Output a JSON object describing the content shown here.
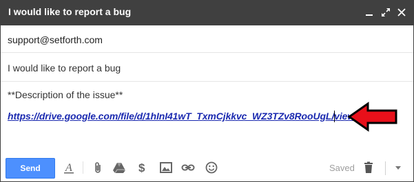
{
  "window": {
    "title": "I would like to report a bug",
    "minimize_icon": "minimize-icon",
    "expand_icon": "expand-icon",
    "close_icon": "close-icon"
  },
  "compose": {
    "to": "support@setforth.com",
    "subject": "I would like to report a bug",
    "body_line1": "**Description of the issue**",
    "body_link": "https://drive.google.com/file/d/1hInI41wT_TxmCjkkvc_WZ3TZv8RooUgL/view"
  },
  "toolbar": {
    "send_label": "Send",
    "saved_label": "Saved",
    "icons": [
      "format-text-icon",
      "attach-icon",
      "drive-icon",
      "money-icon",
      "photo-icon",
      "link-icon",
      "emoji-icon",
      "trash-icon",
      "more-options-icon"
    ]
  },
  "colors": {
    "titlebar": "#404040",
    "send_button": "#4d90fe",
    "link": "#1b2ab0",
    "arrow_fill": "#e8101a"
  },
  "annotation": {
    "arrow_icon": "red-arrow-icon"
  }
}
